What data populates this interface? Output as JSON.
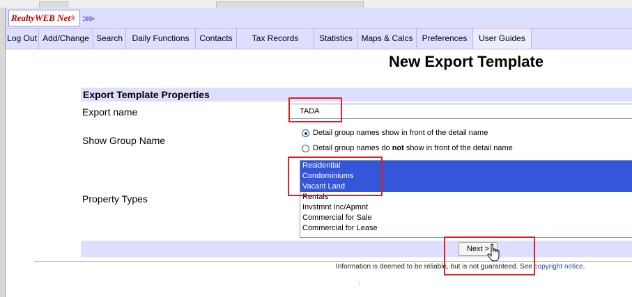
{
  "logo": {
    "text": "RealtyWEB Net",
    "registered": "®"
  },
  "logo_bar": {
    "expand_icon": "double-chevron-right"
  },
  "nav": {
    "items": [
      "Log Out",
      "Add/Change",
      "Search",
      "Daily Functions",
      "Contacts",
      "Tax Records",
      "Statistics",
      "Maps & Calcs",
      "Preferences",
      "User Guides"
    ]
  },
  "page": {
    "title": "New Export Template"
  },
  "form": {
    "section_title": "Export Template Properties",
    "export_name_label": "Export name",
    "export_name_value": "TADA",
    "show_group_label": "Show Group Name",
    "radio_option_1": "Detail group names show in front of the detail name",
    "radio_option_2_pre": "Detail group names do ",
    "radio_option_2_bold": "not",
    "radio_option_2_post": " show in front of the detail name",
    "radio_selected": 1,
    "property_types_label": "Property Types",
    "property_types": [
      {
        "label": "Residential",
        "selected": true
      },
      {
        "label": "Condominiums",
        "selected": true
      },
      {
        "label": "Vacant Land",
        "selected": true
      },
      {
        "label": "Rentals",
        "selected": false
      },
      {
        "label": "Invstmnt Inc/Apmnt",
        "selected": false
      },
      {
        "label": "Commercial for Sale",
        "selected": false
      },
      {
        "label": "Commercial for Lease",
        "selected": false
      }
    ],
    "next_label": "Next >"
  },
  "footer": {
    "disclaimer_text": "Information is deemed to be reliable, but is not guaranteed. See ",
    "copyright_link": "copyright notice",
    "end": "."
  },
  "colors": {
    "accent_bg": "#dedeff",
    "selection": "#3556d8",
    "annotation": "#e02020"
  }
}
